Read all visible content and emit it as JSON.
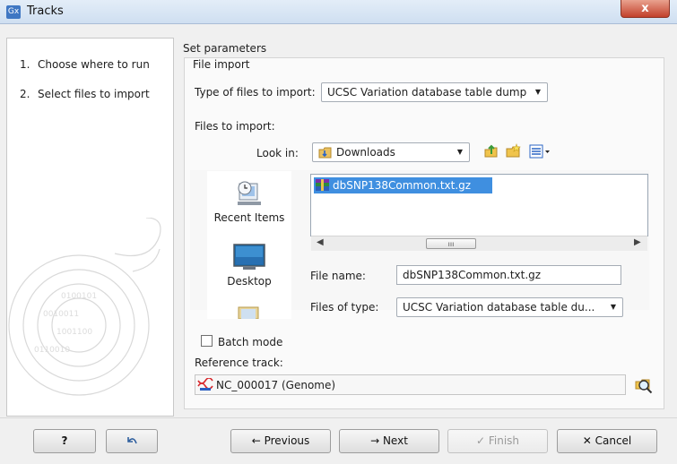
{
  "window": {
    "title": "Tracks",
    "app_icon": "Gx",
    "close_icon": "close-icon",
    "close_glyph": "x"
  },
  "steps": [
    {
      "number": "1.",
      "label": "Choose where to run"
    },
    {
      "number": "2.",
      "label": "Select files to import"
    }
  ],
  "panel": {
    "title": "Set parameters",
    "group_title": "File import",
    "type_label": "Type of files to import:",
    "type_value": "UCSC Variation database table dump",
    "files_label": "Files to import:",
    "look_in_label": "Look in:",
    "look_in_value": "Downloads",
    "places": [
      "Recent Items",
      "Desktop"
    ],
    "files": [
      "dbSNP138Common.txt.gz"
    ],
    "file_name_label": "File name:",
    "file_name_value": "dbSNP138Common.txt.gz",
    "files_of_type_label": "Files of type:",
    "files_of_type_value": "UCSC Variation database table du...",
    "batch_mode_label": "Batch mode",
    "batch_mode_checked": false,
    "reference_label": "Reference track:",
    "reference_value": "NC_000017 (Genome)"
  },
  "buttons": {
    "help": "?",
    "previous": "Previous",
    "next": "Next",
    "finish": "Finish",
    "cancel": "Cancel"
  },
  "colors": {
    "accent": "#3f8fe0",
    "title_bar": "#cfdff1",
    "close": "#c2402b"
  }
}
